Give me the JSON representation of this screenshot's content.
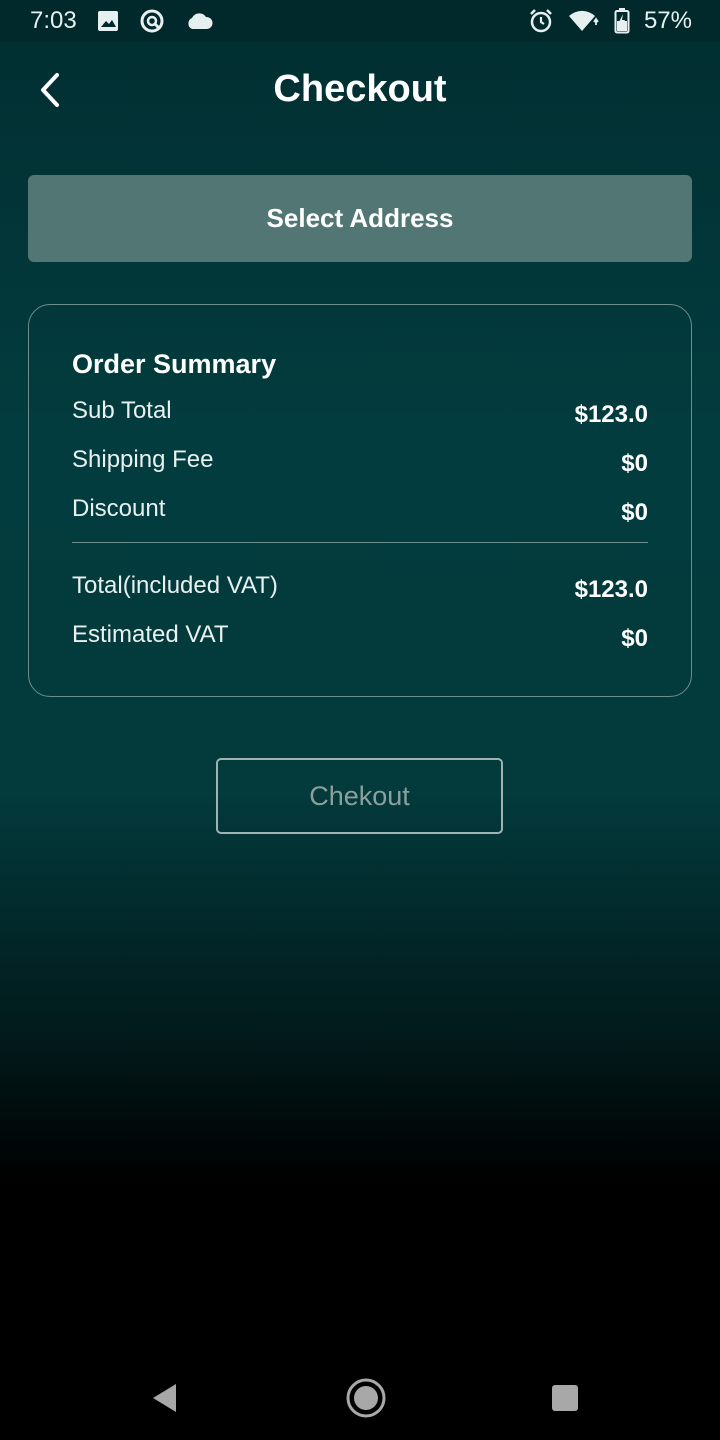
{
  "status_bar": {
    "time": "7:03",
    "left_icons": [
      "image-icon",
      "circle-q-icon",
      "cloud-icon"
    ],
    "right_icons": [
      "alarm-icon",
      "wifi-icon",
      "battery-charging-icon"
    ],
    "battery": "57%"
  },
  "header": {
    "title": "Checkout",
    "back_icon": "chevron-left-icon"
  },
  "select_address": {
    "label": "Select Address"
  },
  "order_summary": {
    "title": "Order Summary",
    "rows": [
      {
        "label": "Sub Total",
        "value": "$123.0"
      },
      {
        "label": "Shipping Fee",
        "value": "$0"
      },
      {
        "label": "Discount",
        "value": "$0"
      }
    ],
    "totals": [
      {
        "label": "Total(included VAT)",
        "value": "$123.0"
      },
      {
        "label": "Estimated VAT",
        "value": "$0"
      }
    ]
  },
  "checkout_button": {
    "label": "Chekout"
  },
  "nav_bar": {
    "icons": [
      "nav-back-icon",
      "nav-home-icon",
      "nav-recent-icon"
    ]
  },
  "colors": {
    "background_top": "#012e31",
    "background_mid": "#033c3e",
    "select_address_bg": "#517674",
    "card_border": "#6c8e8c",
    "checkout_border": "#9fb3b2",
    "checkout_text": "#8c9f9e"
  }
}
